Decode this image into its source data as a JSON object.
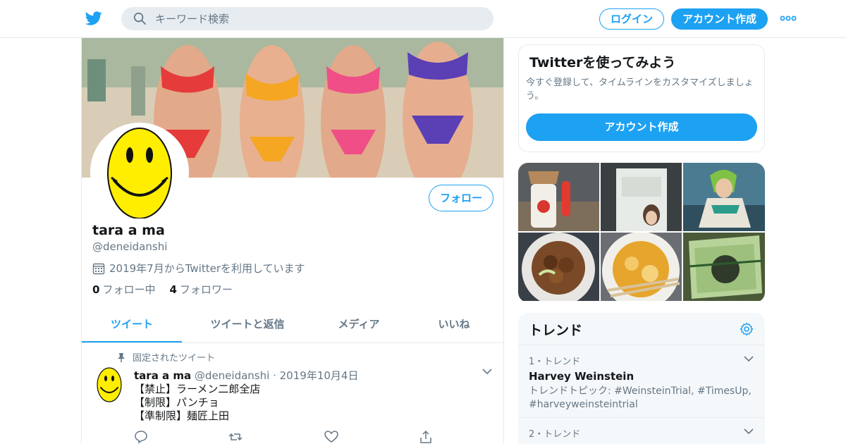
{
  "header": {
    "logo_icon": "twitter-bird-icon",
    "search_placeholder": "キーワード検索",
    "login_label": "ログイン",
    "signup_label": "アカウント作成",
    "more_icon": "more-dots-icon",
    "accent_color": "#1da1f2"
  },
  "profile": {
    "name": "tara a ma",
    "handle": "@deneidanshi",
    "joined": "2019年7月からTwitterを利用しています",
    "follow_label": "フォロー",
    "following_count": "0",
    "following_label": "フォロー中",
    "followers_count": "4",
    "followers_label": "フォロワー"
  },
  "tabs": [
    {
      "label": "ツイート",
      "active": true
    },
    {
      "label": "ツイートと返信",
      "active": false
    },
    {
      "label": "メディア",
      "active": false
    },
    {
      "label": "いいね",
      "active": false
    }
  ],
  "tweet": {
    "pinned_label": "固定されたツイート",
    "name": "tara a ma",
    "handle": "@deneidanshi",
    "separator": "·",
    "date": "2019年10月4日",
    "lines": [
      "【禁止】ラーメン二郎全店",
      "【制限】パンチョ",
      "【準制限】麺匠上田"
    ]
  },
  "signup_card": {
    "title": "Twitterを使ってみよう",
    "description": "今すぐ登録して、タイムラインをカスタマイズしましょう。",
    "button_label": "アカウント作成"
  },
  "trends": {
    "title": "トレンド",
    "items": [
      {
        "meta": "1・トレンド",
        "name": "Harvey Weinstein",
        "desc": "トレンドトピック: #WeinsteinTrial, #TimesUp, #harveyweinsteintrial"
      },
      {
        "meta": "2・トレンド",
        "name": "",
        "desc": ""
      }
    ]
  }
}
